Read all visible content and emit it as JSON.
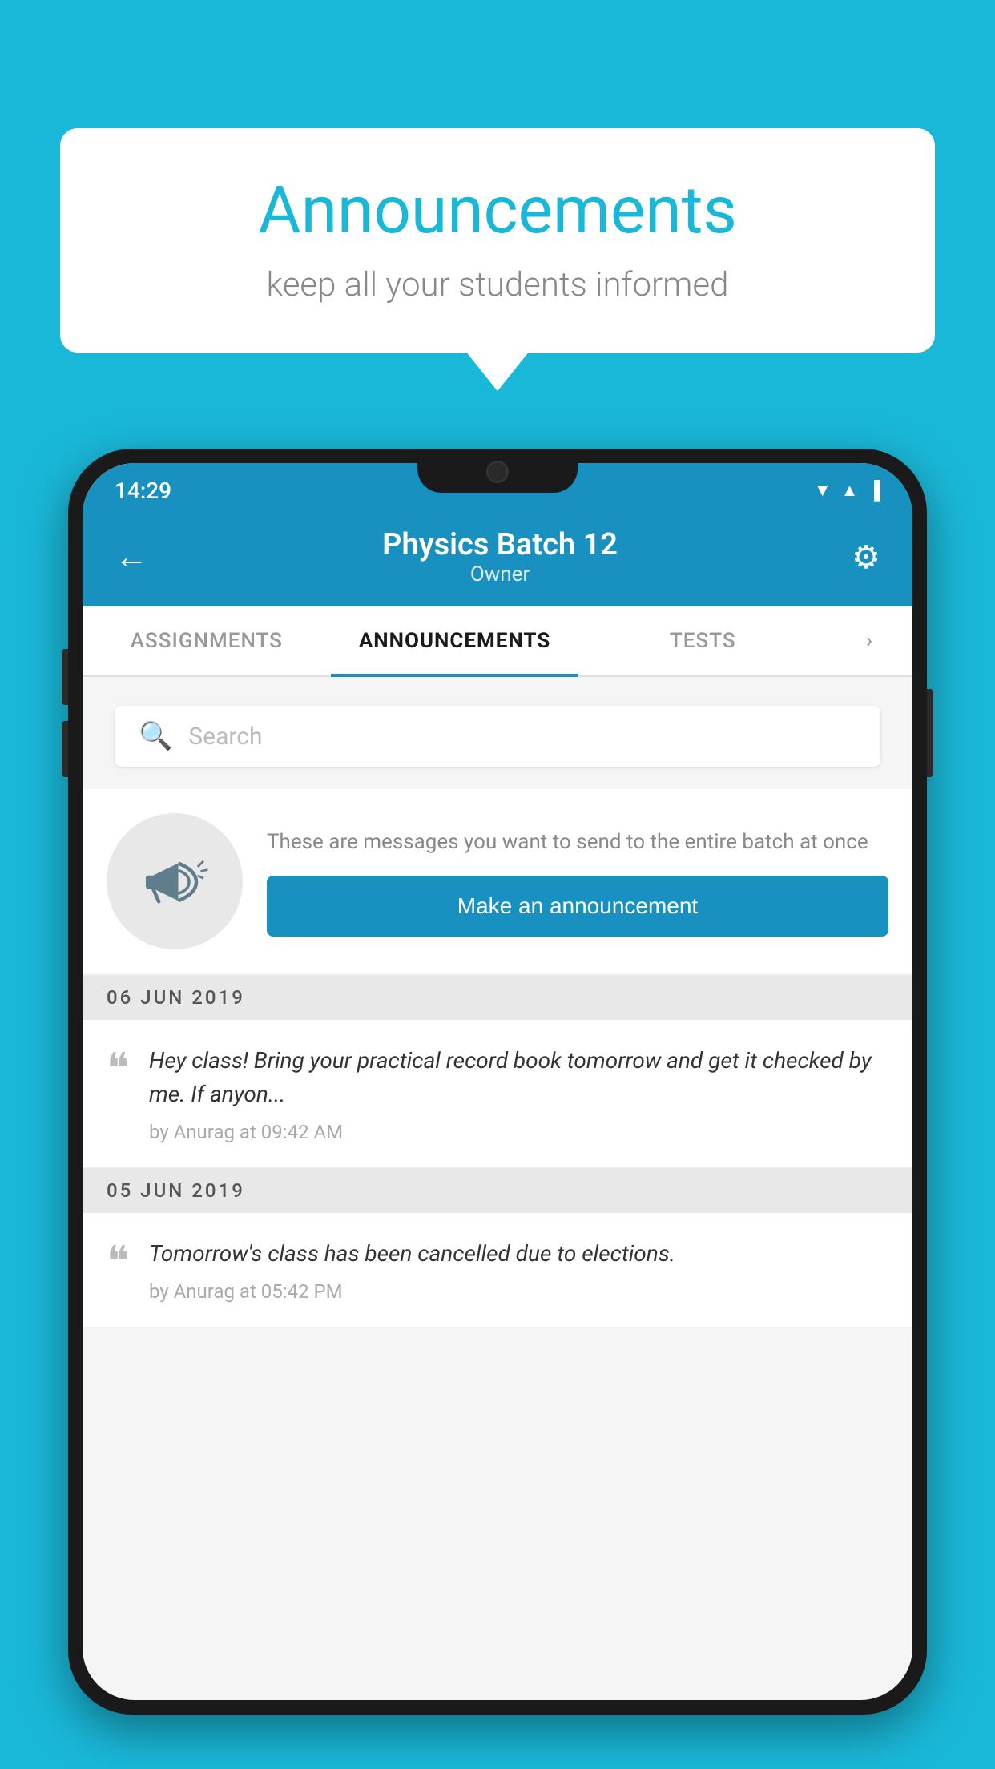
{
  "background_color": "#1ab8d8",
  "speech_bubble": {
    "title": "Announcements",
    "subtitle": "keep all your students informed"
  },
  "phone": {
    "status_bar": {
      "time": "14:29",
      "icons": [
        "▼",
        "▲",
        "▐"
      ]
    },
    "header": {
      "back_label": "←",
      "title": "Physics Batch 12",
      "subtitle": "Owner",
      "gear_label": "⚙"
    },
    "tabs": [
      {
        "label": "ASSIGNMENTS",
        "active": false
      },
      {
        "label": "ANNOUNCEMENTS",
        "active": true
      },
      {
        "label": "TESTS",
        "active": false
      },
      {
        "label": "›",
        "active": false
      }
    ],
    "search": {
      "placeholder": "Search"
    },
    "promo": {
      "description": "These are messages you want to send to the entire batch at once",
      "button_label": "Make an announcement"
    },
    "announcements": [
      {
        "date": "06  JUN  2019",
        "text": "Hey class! Bring your practical record book tomorrow and get it checked by me. If anyon...",
        "meta": "by Anurag at 09:42 AM"
      },
      {
        "date": "05  JUN  2019",
        "text": "Tomorrow's class has been cancelled due to elections.",
        "meta": "by Anurag at 05:42 PM"
      }
    ]
  }
}
